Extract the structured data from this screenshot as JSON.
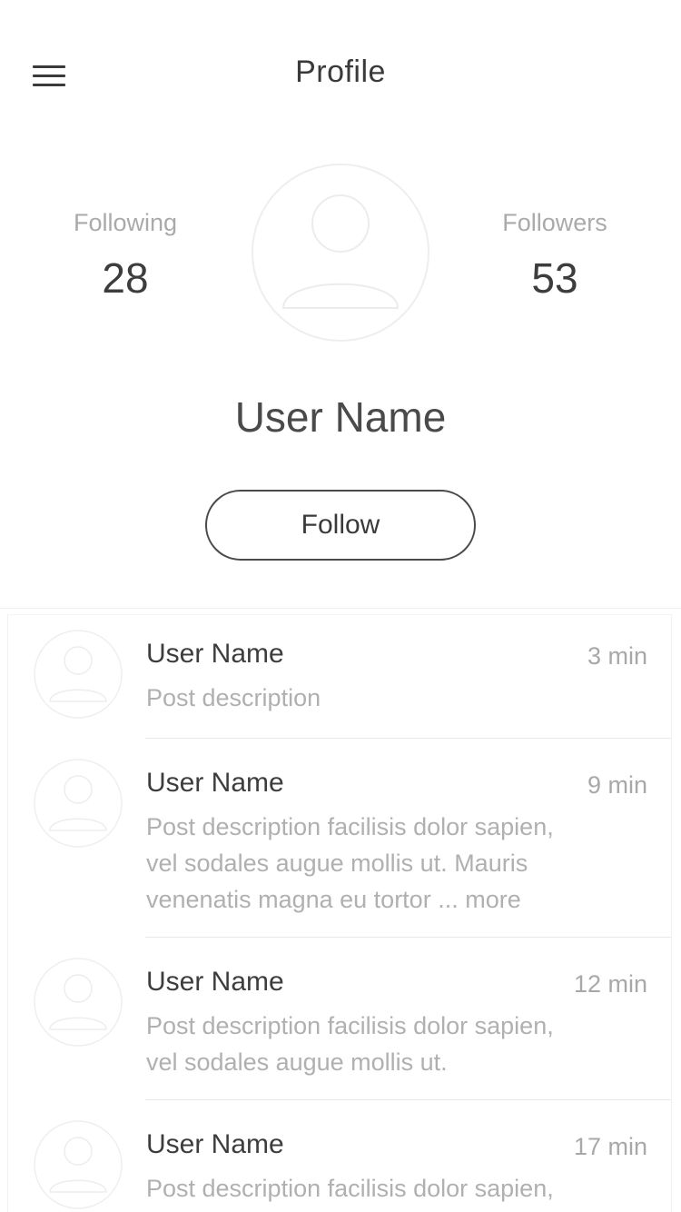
{
  "header": {
    "title": "Profile",
    "menu_icon": "hamburger-menu-icon"
  },
  "profile": {
    "following_label": "Following",
    "following_count": "28",
    "followers_label": "Followers",
    "followers_count": "53",
    "avatar_icon": "user-avatar-icon",
    "user_name": "User Name",
    "follow_label": "Follow"
  },
  "colors": {
    "text_dark": "#3d3d3d",
    "text_muted": "#aaaaaa",
    "avatar_outline": "#eeeeee",
    "divider": "#e8e8e8"
  },
  "posts": [
    {
      "author": "User Name",
      "time": "3 min",
      "lines": [
        "Post description"
      ]
    },
    {
      "author": "User Name",
      "time": "9 min",
      "lines": [
        "Post description facilisis dolor sapien,",
        "vel sodales augue mollis ut. Mauris",
        "venenatis magna eu tortor ... more"
      ]
    },
    {
      "author": "User Name",
      "time": "12 min",
      "lines": [
        "Post description facilisis dolor sapien,",
        "vel sodales augue mollis ut."
      ]
    },
    {
      "author": "User Name",
      "time": "17 min",
      "lines": [
        "Post description facilisis dolor sapien,"
      ]
    }
  ]
}
